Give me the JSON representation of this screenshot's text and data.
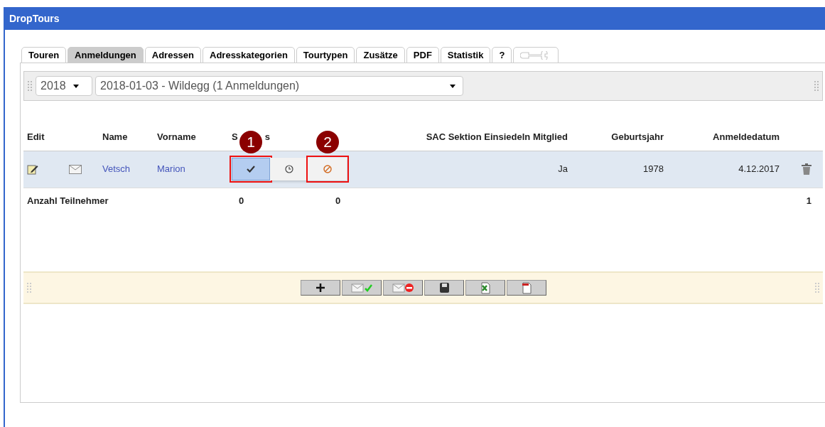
{
  "window": {
    "title": "DropTours"
  },
  "tabs": [
    {
      "label": "Touren",
      "selected": false
    },
    {
      "label": "Anmeldungen",
      "selected": true
    },
    {
      "label": "Adressen",
      "selected": false
    },
    {
      "label": "Adresskategorien",
      "selected": false
    },
    {
      "label": "Tourtypen",
      "selected": false
    },
    {
      "label": "Zusätze",
      "selected": false
    },
    {
      "label": "PDF",
      "selected": false
    },
    {
      "label": "Statistik",
      "selected": false
    },
    {
      "label": "?",
      "selected": false
    },
    {
      "kind": "tools",
      "disabled": true,
      "selected": false
    }
  ],
  "filters": {
    "year": "2018",
    "tour": "2018-01-03 - Wildegg (1 Anmeldungen)"
  },
  "table": {
    "columns": [
      "Edit",
      "Name",
      "Vorname",
      "S",
      "SAC Sektion Einsiedeln Mitglied",
      "Geburtsjahr",
      "Anmeldedatum"
    ],
    "status_header_tail": "s",
    "rows": [
      {
        "name": "Vetsch",
        "vorname": "Marion",
        "status": [
          {
            "kind": "confirmed",
            "selected": true,
            "badge": "1"
          },
          {
            "kind": "waiting",
            "selected": false
          },
          {
            "kind": "rejected",
            "selected": false,
            "badge": "2"
          }
        ],
        "mitglied": "Ja",
        "geburtsjahr": "1978",
        "anmeldedatum": "4.12.2017"
      }
    ],
    "footer": {
      "label": "Anzahl Teilnehmer",
      "confirmed": "0",
      "rejected": "0",
      "total": "1"
    }
  },
  "toolbar": [
    {
      "kind": "add"
    },
    {
      "kind": "mail-confirm"
    },
    {
      "kind": "mail-reject"
    },
    {
      "kind": "save"
    },
    {
      "kind": "excel"
    },
    {
      "kind": "pdf"
    }
  ]
}
